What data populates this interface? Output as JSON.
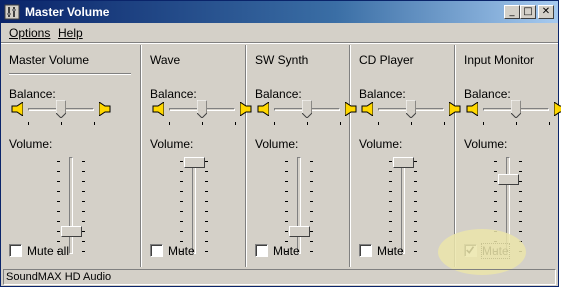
{
  "window": {
    "title": "Master Volume"
  },
  "menu": {
    "items": [
      "Options",
      "Help"
    ]
  },
  "labels": {
    "balance": "Balance:",
    "volume": "Volume:"
  },
  "columns": [
    {
      "name": "Master Volume",
      "mute_label": "Mute all",
      "mute_checked": false,
      "balance": 0.5,
      "volume": 0.2
    },
    {
      "name": "Wave",
      "mute_label": "Mute",
      "mute_checked": false,
      "balance": 0.5,
      "volume": 1.0
    },
    {
      "name": "SW Synth",
      "mute_label": "Mute",
      "mute_checked": false,
      "balance": 0.5,
      "volume": 0.2
    },
    {
      "name": "CD Player",
      "mute_label": "Mute",
      "mute_checked": false,
      "balance": 0.5,
      "volume": 1.0
    },
    {
      "name": "Input Monitor",
      "mute_label": "Mute",
      "mute_checked": true,
      "balance": 0.5,
      "volume": 0.8
    }
  ],
  "status": {
    "text": "SoundMAX HD Audio"
  },
  "colors": {
    "titlebar": "#0a246a",
    "face": "#d4d0c8",
    "speaker": "#ffd700",
    "highlight": "#ebe5aa"
  }
}
